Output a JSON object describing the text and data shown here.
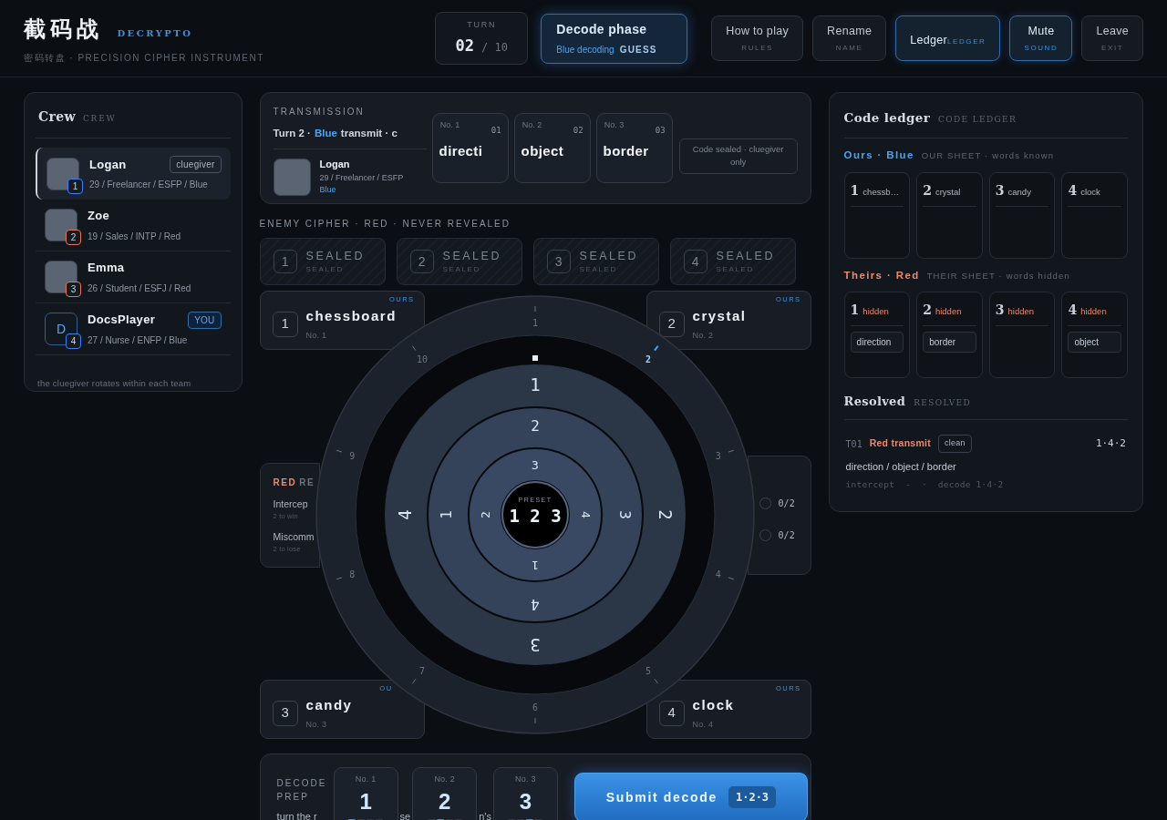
{
  "header": {
    "title": "截码战",
    "brand": "DECRYPTO",
    "subtitle": "密码转盘 · PRECISION CIPHER INSTRUMENT",
    "turn": {
      "label": "TURN",
      "current": "02",
      "total": "/ 10"
    },
    "phase": {
      "title": "Decode phase",
      "team": "Blue decoding",
      "step": "GUESS"
    },
    "buttons": [
      {
        "label": "How to play",
        "sub": "RULES",
        "active": false,
        "kind": "stacked"
      },
      {
        "label": "Rename",
        "sub": "NAME",
        "active": false,
        "kind": "stacked"
      },
      {
        "label": "Ledger",
        "sub": "LEDGER",
        "active": true,
        "kind": "inline"
      },
      {
        "label": "Mute",
        "sub": "SOUND",
        "active": true,
        "kind": "stacked"
      },
      {
        "label": "Leave",
        "sub": "EXIT",
        "active": false,
        "kind": "stacked"
      }
    ]
  },
  "crew": {
    "title": "Crew",
    "sub": "CREW",
    "players": [
      {
        "name": "Logan",
        "info": "29 / Freelancer / ESFP / Blue",
        "seat": "1",
        "color": "#3b82f6",
        "selected": true,
        "tag": {
          "text": "cluegiver",
          "kind": "role"
        },
        "kind": "photo"
      },
      {
        "name": "Zoe",
        "info": "19 / Sales / INTP / Red",
        "seat": "2",
        "color": "#e0785f",
        "selected": false,
        "kind": "photo"
      },
      {
        "name": "Emma",
        "info": "26 / Student / ESFJ / Red",
        "seat": "3",
        "color": "#e0785f",
        "selected": false,
        "kind": "photo"
      },
      {
        "name": "DocsPlayer",
        "info": "27 / Nurse / ENFP / Blue",
        "seat": "4",
        "color": "#3b82f6",
        "selected": false,
        "tag": {
          "text": "YOU",
          "kind": "self"
        },
        "kind": "initial",
        "initial": "D"
      }
    ],
    "footer": "the cluegiver rotates within each team"
  },
  "transmission": {
    "label": "TRANSMISSION",
    "turn": "Turn 2 ·",
    "team": "Blue",
    "rest": "transmit · c",
    "cluegiver": {
      "name": "Logan",
      "info": "29 / Freelancer / ESFP",
      "team": "Blue"
    },
    "clues": [
      {
        "label": "No. 1",
        "code": "01",
        "word": "directi"
      },
      {
        "label": "No. 2",
        "code": "02",
        "word": "object"
      },
      {
        "label": "No. 3",
        "code": "03",
        "word": "border"
      }
    ],
    "note": "Code sealed · cluegiver only"
  },
  "enemy": {
    "label": "ENEMY CIPHER · RED · NEVER REVEALED",
    "slots": [
      {
        "number": "1",
        "title": "SEALED",
        "sub": "SEALED"
      },
      {
        "number": "2",
        "title": "SEALED",
        "sub": "SEALED"
      },
      {
        "number": "3",
        "title": "SEALED",
        "sub": "SEALED"
      },
      {
        "number": "4",
        "title": "SEALED",
        "sub": "SEALED"
      }
    ]
  },
  "words": [
    {
      "number": "1",
      "word": "chessboard",
      "label": "No. 1",
      "tag": "OURS"
    },
    {
      "number": "2",
      "word": "crystal",
      "label": "No. 2",
      "tag": "OURS"
    },
    {
      "number": "3",
      "word": "candy",
      "label": "No. 3",
      "tag": "OU"
    },
    {
      "number": "4",
      "word": "clock",
      "label": "No. 4",
      "tag": "OURS"
    }
  ],
  "red_panel": {
    "team": "RED",
    "rest": "RE",
    "rows": [
      {
        "label": "Intercep",
        "sub": "2 to win"
      },
      {
        "label": "Miscomm",
        "sub": "2 to lose"
      }
    ]
  },
  "blue_panel": {
    "rows": [
      {
        "value": "0/2",
        "checked": false
      },
      {
        "value": "0/2",
        "checked": false
      }
    ]
  },
  "dial": {
    "ticks": [
      {
        "label": "1",
        "selected": false
      },
      {
        "label": "2",
        "selected": true
      },
      {
        "label": "3",
        "selected": false
      },
      {
        "label": "4",
        "selected": false
      },
      {
        "label": "5",
        "selected": false
      },
      {
        "label": "6",
        "selected": false
      },
      {
        "label": "7",
        "selected": false
      },
      {
        "label": "8",
        "selected": false
      },
      {
        "label": "9",
        "selected": false
      },
      {
        "label": "10",
        "selected": false
      }
    ],
    "rings": [
      {
        "digits": [
          "1",
          "2",
          "3",
          "4"
        ]
      },
      {
        "digits": [
          "2",
          "3",
          "4",
          "1"
        ]
      },
      {
        "digits": [
          "3",
          "4",
          "1",
          "2"
        ]
      }
    ],
    "preset_label": "PRESET",
    "preset": "1 2 3"
  },
  "decode": {
    "label": "DECODE PREP",
    "hint": [
      "turn the r",
      "se",
      "n's"
    ],
    "slots": [
      {
        "label": "No. 1",
        "value": "1",
        "segments": [
          {
            "selected": true
          },
          {
            "selected": false
          },
          {
            "selected": false
          },
          {
            "selected": false
          }
        ]
      },
      {
        "label": "No. 2",
        "value": "2",
        "segments": [
          {
            "selected": false
          },
          {
            "selected": true
          },
          {
            "selected": false
          },
          {
            "selected": false
          }
        ]
      },
      {
        "label": "No. 3",
        "value": "3",
        "segments": [
          {
            "selected": false
          },
          {
            "selected": false
          },
          {
            "selected": true
          },
          {
            "selected": false
          }
        ]
      }
    ],
    "submit": {
      "label": "Submit decode",
      "code": "1·2·3"
    }
  },
  "ledger": {
    "title": "Code ledger",
    "sub": "CODE LEDGER",
    "ours": {
      "team": "Ours · Blue",
      "color": "#4aa3f0",
      "sub": "OUR SHEET · words known",
      "cards": [
        {
          "number": "1",
          "word": "chessb…"
        },
        {
          "number": "2",
          "word": "crystal"
        },
        {
          "number": "3",
          "word": "candy"
        },
        {
          "number": "4",
          "word": "clock"
        }
      ]
    },
    "theirs": {
      "team": "Theirs · Red",
      "color": "#e8896f",
      "sub": "THEIR SHEET · words hidden",
      "cards": [
        {
          "number": "1",
          "word": "hidden",
          "notes": [
            "direction"
          ]
        },
        {
          "number": "2",
          "word": "hidden",
          "notes": [
            "border"
          ]
        },
        {
          "number": "3",
          "word": "hidden"
        },
        {
          "number": "4",
          "word": "hidden",
          "notes": [
            "object"
          ]
        }
      ]
    },
    "resolved": {
      "title": "Resolved",
      "sub": "RESOLVED",
      "entries": [
        {
          "turn": "T01",
          "team": "Red transmit",
          "tag": "clean",
          "code": "1·4·2",
          "words": "direction / object / border",
          "detail": "intercept  -  ·  decode 1·4·2"
        }
      ]
    }
  }
}
